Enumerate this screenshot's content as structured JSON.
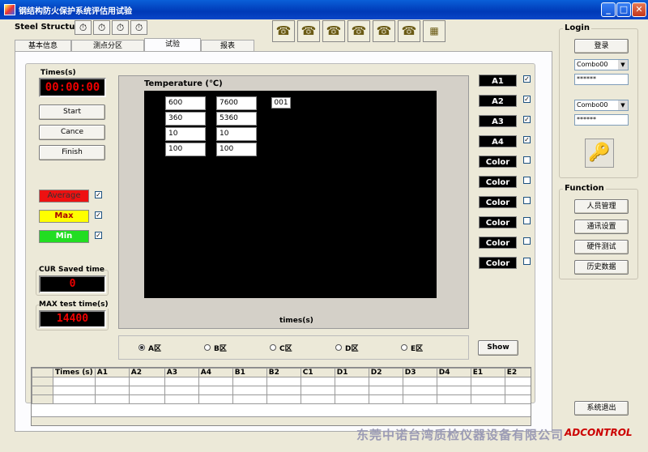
{
  "window": {
    "title": "钢结构防火保护系统评估用试验",
    "min": "_",
    "max": "□",
    "close": "✕"
  },
  "app_title": "Steel Structur",
  "tabs": [
    "基本信息",
    "测点分区",
    "试验",
    "报表"
  ],
  "timer": {
    "label": "Times(s)",
    "value": "00:00:00"
  },
  "buttons": {
    "start": "Start",
    "cancel": "Cance",
    "finish": "Finish",
    "show": "Show"
  },
  "legend": [
    {
      "label": "Average",
      "color": "#ee1111"
    },
    {
      "label": "Max",
      "color": "#ffff00"
    },
    {
      "label": "Min",
      "color": "#22dd22"
    }
  ],
  "cur_saved": {
    "label": "CUR Saved time",
    "value": "0"
  },
  "max_test": {
    "label": "MAX test time(s)",
    "value": "14400"
  },
  "chart": {
    "title": "Temperature (℃)",
    "xlabel": "times(s)",
    "col1": [
      "600",
      "360",
      "10",
      "100"
    ],
    "col2": [
      "7600",
      "5360",
      "10",
      "100"
    ],
    "tag": "001"
  },
  "series_buttons": [
    {
      "label": "A1",
      "checked": true
    },
    {
      "label": "A2",
      "checked": true
    },
    {
      "label": "A3",
      "checked": true
    },
    {
      "label": "A4",
      "checked": true
    },
    {
      "label": "Color",
      "checked": false
    },
    {
      "label": "Color",
      "checked": false
    },
    {
      "label": "Color",
      "checked": false
    },
    {
      "label": "Color",
      "checked": false
    },
    {
      "label": "Color",
      "checked": false
    },
    {
      "label": "Color",
      "checked": false
    }
  ],
  "zones": [
    "A区",
    "B区",
    "C区",
    "D区",
    "E区"
  ],
  "table_headers": [
    "Times (s)",
    "A1",
    "A2",
    "A3",
    "A4",
    "B1",
    "B2",
    "C1",
    "D1",
    "D2",
    "D3",
    "D4",
    "E1",
    "E2"
  ],
  "login": {
    "title": "Login",
    "button": "登录",
    "combo1": "Combo00",
    "pw1": "******",
    "combo2": "Combo00",
    "pw2": "******"
  },
  "function": {
    "title": "Function",
    "items": [
      "人员管理",
      "通讯设置",
      "硬件测试",
      "历史数据"
    ],
    "exit": "系统退出"
  },
  "watermark": "东莞中诺台湾质检仪器设备有限公司",
  "logo": "ADCONTROL"
}
